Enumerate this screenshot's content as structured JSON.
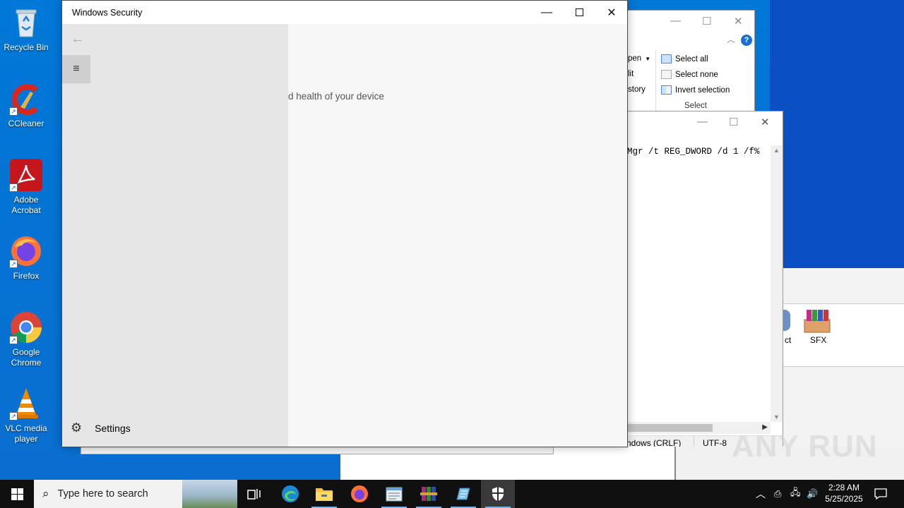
{
  "desktop": {
    "icons": [
      {
        "label": "Recycle Bin"
      },
      {
        "label": "CCleaner"
      },
      {
        "label": "Adobe Acrobat"
      },
      {
        "label": "Firefox"
      },
      {
        "label": "Google Chrome"
      },
      {
        "label": "VLC media player"
      }
    ]
  },
  "explorer": {
    "ribbon_left": [
      "pen",
      "lit",
      "story"
    ],
    "select_all": "Select all",
    "select_none": "Select none",
    "invert_selection": "Invert selection",
    "group_label": "Select",
    "help": "?"
  },
  "notepad": {
    "text": "Mgr /t REG_DWORD /d 1 /f%",
    "line_ending": "ndows (CRLF)",
    "encoding": "UTF-8"
  },
  "winrar": {
    "partial_label": "ct",
    "sfx_label": "SFX"
  },
  "window": {
    "title": "Windows Security",
    "subtext": "d health of your device",
    "settings_label": "Settings"
  },
  "taskbar": {
    "search_placeholder": "Type here to search",
    "time": "2:28 AM",
    "date": "5/25/2025"
  },
  "watermark": "ANY RUN",
  "colors": {
    "desktop": "#0078d7",
    "sidebar": "#e6e6e6",
    "taskbar": "#101010",
    "accent": "#0078d7"
  }
}
